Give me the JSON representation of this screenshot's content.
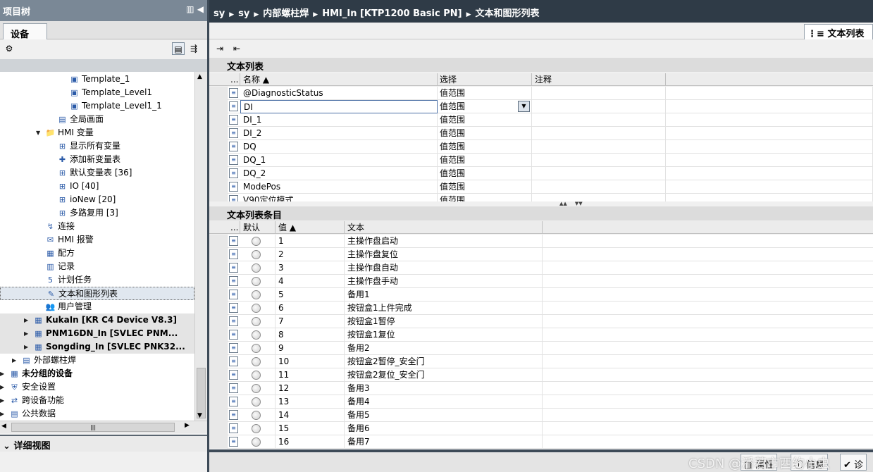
{
  "left": {
    "title": "项目树",
    "controls": "▥ ◀",
    "tab": "设备",
    "tree": [
      {
        "label": "Template_1",
        "icon": "screen-template-icon",
        "glyph": "▣",
        "level": 7
      },
      {
        "label": "Template_Level1",
        "icon": "screen-template-icon",
        "glyph": "▣",
        "level": 7
      },
      {
        "label": "Template_Level1_1",
        "icon": "screen-template-icon",
        "glyph": "▣",
        "level": 7
      },
      {
        "label": "全局画面",
        "icon": "global-screen-icon",
        "glyph": "▤",
        "level": 6
      },
      {
        "label": "HMI 变量",
        "icon": "folder-icon",
        "glyph": "📁",
        "level": 5,
        "arrow": "▼"
      },
      {
        "label": "显示所有变量",
        "icon": "tags-icon",
        "glyph": "⊞",
        "level": 6
      },
      {
        "label": "添加新变量表",
        "icon": "add-tag-table-icon",
        "glyph": "✚",
        "level": 6
      },
      {
        "label": "默认变量表 [36]",
        "icon": "tag-table-icon",
        "glyph": "⊞",
        "level": 6
      },
      {
        "label": "IO [40]",
        "icon": "tag-table-icon",
        "glyph": "⊞",
        "level": 6
      },
      {
        "label": "ioNew [20]",
        "icon": "tag-table-icon",
        "glyph": "⊞",
        "level": 6
      },
      {
        "label": "多路复用 [3]",
        "icon": "tag-table-icon",
        "glyph": "⊞",
        "level": 6
      },
      {
        "label": "连接",
        "icon": "connection-icon",
        "glyph": "↯",
        "level": 5
      },
      {
        "label": "HMI 报警",
        "icon": "alarm-icon",
        "glyph": "✉",
        "level": 5
      },
      {
        "label": "配方",
        "icon": "recipe-icon",
        "glyph": "▦",
        "level": 5
      },
      {
        "label": "记录",
        "icon": "log-icon",
        "glyph": "▥",
        "level": 5
      },
      {
        "label": "计划任务",
        "icon": "scheduler-icon",
        "glyph": "5",
        "level": 5
      },
      {
        "label": "文本和图形列表",
        "icon": "text-graphic-list-icon",
        "glyph": "✎",
        "level": 5,
        "selected": true
      },
      {
        "label": "用户管理",
        "icon": "user-admin-icon",
        "glyph": "👥",
        "level": 5
      },
      {
        "label": "KukaIn [KR C4 Device V8.3]",
        "icon": "device-icon",
        "glyph": "▦",
        "level": 4,
        "arrow": "▶",
        "bold": true,
        "gray": true
      },
      {
        "label": "PNM16DN_In [SVLEC PNM...",
        "icon": "device-icon",
        "glyph": "▦",
        "level": 4,
        "arrow": "▶",
        "bold": true,
        "gray": true
      },
      {
        "label": "Songding_In [SVLEC PNK32...",
        "icon": "device-icon",
        "glyph": "▦",
        "level": 4,
        "arrow": "▶",
        "bold": true,
        "gray": true
      },
      {
        "label": "外部螺柱焊",
        "icon": "folder-icon",
        "glyph": "▤",
        "level": 3,
        "arrow": "▶"
      },
      {
        "label": "未分组的设备",
        "icon": "ungrouped-devices-icon",
        "glyph": "▦",
        "level": 2,
        "arrow": "▶",
        "bold": true
      },
      {
        "label": "安全设置",
        "icon": "security-icon",
        "glyph": "⛨",
        "level": 2,
        "arrow": "▶"
      },
      {
        "label": "跨设备功能",
        "icon": "cross-device-icon",
        "glyph": "⇄",
        "level": 2,
        "arrow": "▶"
      },
      {
        "label": "公共数据",
        "icon": "common-data-icon",
        "glyph": "▤",
        "level": 2,
        "arrow": "▶"
      }
    ],
    "detail_view": "详细视图"
  },
  "breadcrumb": [
    "sy",
    "sy",
    "内部螺柱焊",
    "HMI_In [KTP1200 Basic PN]",
    "文本和图形列表"
  ],
  "right_tab": "文本列表",
  "text_lists": {
    "title": "文本列表",
    "headers": [
      "...",
      "名称 ▲",
      "选择",
      "注释"
    ],
    "rows": [
      {
        "name": "@DiagnosticStatus",
        "selection": "值范围",
        "comment": ""
      },
      {
        "name": "DI",
        "selection": "值范围",
        "comment": "",
        "editing": true
      },
      {
        "name": "DI_1",
        "selection": "值范围",
        "comment": ""
      },
      {
        "name": "DI_2",
        "selection": "值范围",
        "comment": ""
      },
      {
        "name": "DQ",
        "selection": "值范围",
        "comment": ""
      },
      {
        "name": "DQ_1",
        "selection": "值范围",
        "comment": ""
      },
      {
        "name": "DQ_2",
        "selection": "值范围",
        "comment": ""
      },
      {
        "name": "ModePos",
        "selection": "值范围",
        "comment": ""
      },
      {
        "name": "V90定位模式",
        "selection": "值范围",
        "comment": ""
      }
    ]
  },
  "entries": {
    "title": "文本列表条目",
    "headers": [
      "...",
      "默认",
      "值 ▲",
      "文本"
    ],
    "rows": [
      {
        "value": "1",
        "text": "主操作盘启动"
      },
      {
        "value": "2",
        "text": "主操作盘复位"
      },
      {
        "value": "3",
        "text": "主操作盘自动"
      },
      {
        "value": "4",
        "text": "主操作盘手动"
      },
      {
        "value": "5",
        "text": "备用1"
      },
      {
        "value": "6",
        "text": "按钮盒1上件完成"
      },
      {
        "value": "7",
        "text": "按钮盒1暂停"
      },
      {
        "value": "8",
        "text": "按钮盒1复位"
      },
      {
        "value": "9",
        "text": "备用2"
      },
      {
        "value": "10",
        "text": "按钮盒2暂停_安全门"
      },
      {
        "value": "11",
        "text": "按钮盒2复位_安全门"
      },
      {
        "value": "12",
        "text": "备用3"
      },
      {
        "value": "13",
        "text": "备用4"
      },
      {
        "value": "14",
        "text": "备用5"
      },
      {
        "value": "15",
        "text": "备用6"
      },
      {
        "value": "16",
        "text": "备用7"
      }
    ]
  },
  "status_tabs": [
    "属性",
    "信息",
    "诊"
  ],
  "watermark": "CSDN @潘若市西约小虫"
}
